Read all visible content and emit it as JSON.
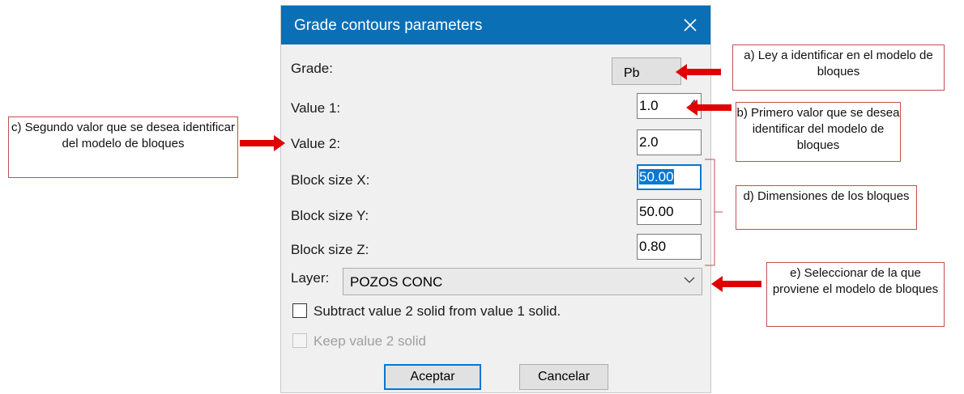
{
  "dialog": {
    "title": "Grade contours parameters",
    "close_glyph": "✕",
    "grade": {
      "label": "Grade:",
      "value": "Pb"
    },
    "value1": {
      "label": "Value 1:",
      "value": "1.0"
    },
    "value2": {
      "label": "Value 2:",
      "value": "2.0"
    },
    "block_x": {
      "label": "Block size X:",
      "value": "50.00"
    },
    "block_y": {
      "label": "Block size Y:",
      "value": "50.00"
    },
    "block_z": {
      "label": "Block size Z:",
      "value": "0.80"
    },
    "layer": {
      "label": "Layer:",
      "value": "POZOS CONC"
    },
    "subtract_label": "Subtract value 2 solid from value 1 solid.",
    "keep_label": "Keep value 2 solid",
    "ok_label": "Aceptar",
    "cancel_label": "Cancelar"
  },
  "annotations": {
    "a": "a) Ley a identificar en el modelo de bloques",
    "b": "b) Primero valor que se desea identificar del modelo de bloques",
    "c": "c) Segundo valor que se desea identificar del modelo de bloques",
    "d": "d) Dimensiones de los bloques",
    "e": "e) Seleccionar de la que proviene el modelo de bloques"
  },
  "colors": {
    "titlebar": "#0b6fb6",
    "annotation_arrow": "#e00000",
    "annotation_border": "#c0504d",
    "selection": "#0078d7"
  }
}
